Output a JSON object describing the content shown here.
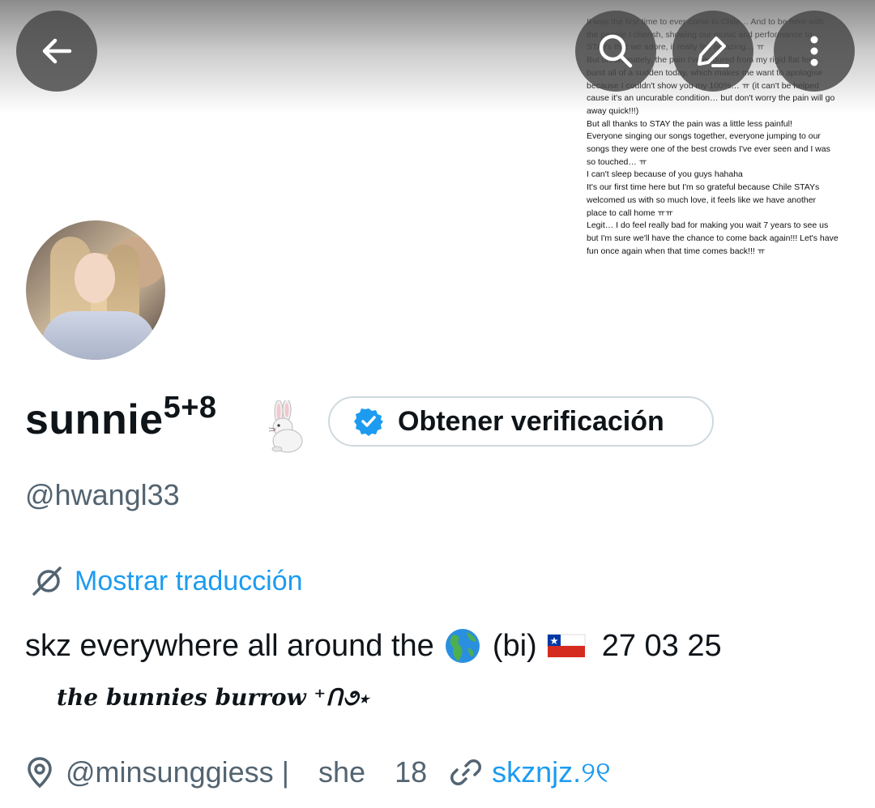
{
  "header": {
    "banner_text": [
      "It was the first time to ever come to Chile… And to be here with",
      "the people I cherish, showing our music and performance to",
      "STAYs that we adore, it really felt amazing… ㅠ",
      "But unfortunately, the pain I've endured from my rigid flat feet",
      "burst all of a sudden today, which makes me want to apologise",
      "because I couldn't show you my 100%… ㅠ (it can't be helped",
      "cause it's an uncurable condition… but don't worry the pain will go",
      "away quick!!!)",
      "But all thanks to STAY the pain was a little less painful!",
      "Everyone singing our songs together, everyone jumping to our",
      "songs they were one of the best crowds I've ever seen and I was",
      "so touched… ㅠ",
      "I can't sleep because of you guys hahaha",
      "It's our first time here but I'm so grateful because Chile STAYs",
      "welcomed us with so much love, it feels like we have another",
      "place to call home ㅠㅠ",
      "Legit… I do feel really bad for making you wait 7 years to see us",
      "but I'm sure we'll have the chance to come back again!!! Let's have",
      "fun once again when that time comes back!!! ㅠ"
    ],
    "icons": {
      "back": "arrow-left-icon",
      "search": "search-icon",
      "edit": "edit-icon",
      "more": "more-vertical-icon"
    }
  },
  "profile": {
    "name": "sunnie",
    "name_superscript": "5+8",
    "name_emoji": "rabbit",
    "verify_button_label": "Obtener verificación",
    "handle": "@hwangl33",
    "translate_label": "Mostrar traducción",
    "bio_part1": "skz everywhere all around the",
    "bio_part2": "(bi)",
    "bio_part3": "27 03 25",
    "bio_emojis": [
      "globe-americas",
      "flag-chile"
    ],
    "fancy_line": "the bunnies burrow ⁺ᑎ૭⋆",
    "meta": {
      "location": "@minsunggiess |",
      "pronoun": "she",
      "age": "18",
      "link": "skznjz.୨୧"
    },
    "colors": {
      "accent": "#1d9bf0",
      "secondary_text": "#536471",
      "primary_text": "#0f1419"
    }
  }
}
